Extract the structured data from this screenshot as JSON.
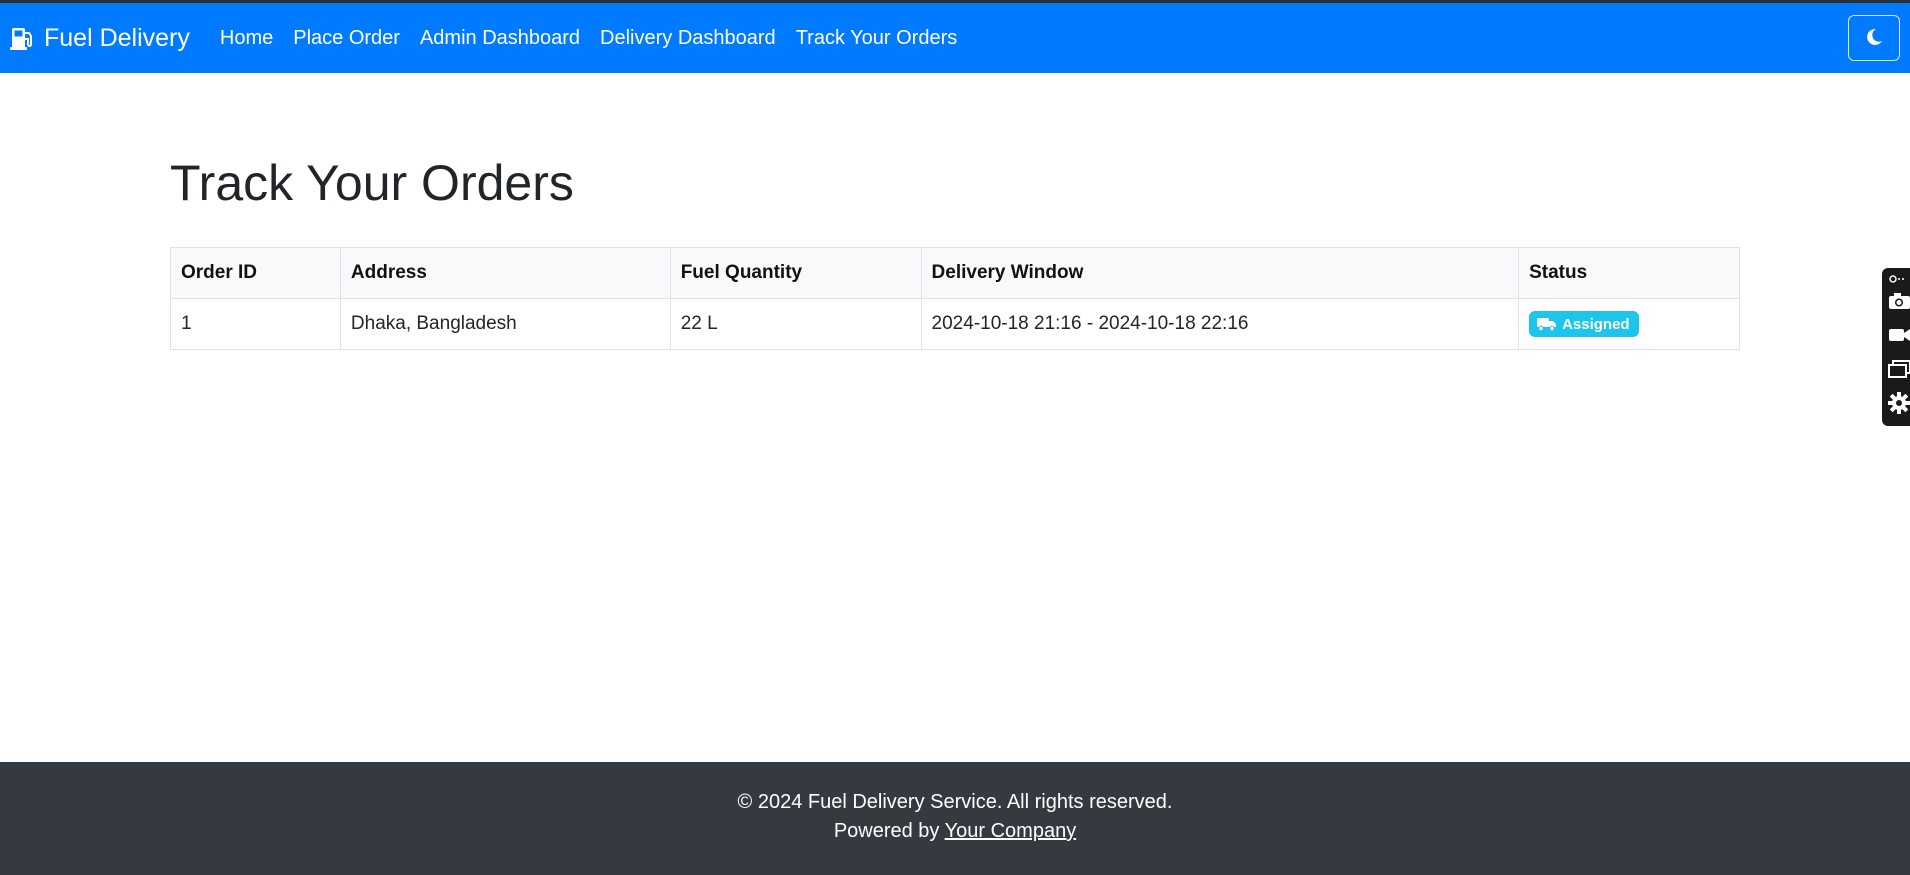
{
  "colors": {
    "navbar": "#007bff",
    "footer": "#343a40",
    "badge_assigned": "#1ec5ea",
    "table_header_bg": "#f8f9fa"
  },
  "navbar": {
    "brand_icon": "gas-pump-icon",
    "brand": "Fuel Delivery",
    "links": [
      {
        "label": "Home"
      },
      {
        "label": "Place Order"
      },
      {
        "label": "Admin Dashboard"
      },
      {
        "label": "Delivery Dashboard"
      },
      {
        "label": "Track Your Orders"
      }
    ],
    "theme_toggle_icon": "moon-icon"
  },
  "main": {
    "title": "Track Your Orders",
    "table": {
      "headers": [
        "Order ID",
        "Address",
        "Fuel Quantity",
        "Delivery Window",
        "Status"
      ],
      "rows": [
        {
          "order_id": "1",
          "address": "Dhaka, Bangladesh",
          "fuel_quantity": "22 L",
          "delivery_window": "2024-10-18 21:16 - 2024-10-18 22:16",
          "status": "Assigned",
          "status_icon": "truck-icon"
        }
      ]
    }
  },
  "footer": {
    "copyright": "© 2024 Fuel Delivery Service. All rights reserved.",
    "powered_prefix": "Powered by ",
    "powered_link": "Your Company"
  },
  "side_toolbar": {
    "icons": [
      "link-icon",
      "camera-icon",
      "video-icon",
      "window-icon",
      "gear-icon"
    ]
  }
}
